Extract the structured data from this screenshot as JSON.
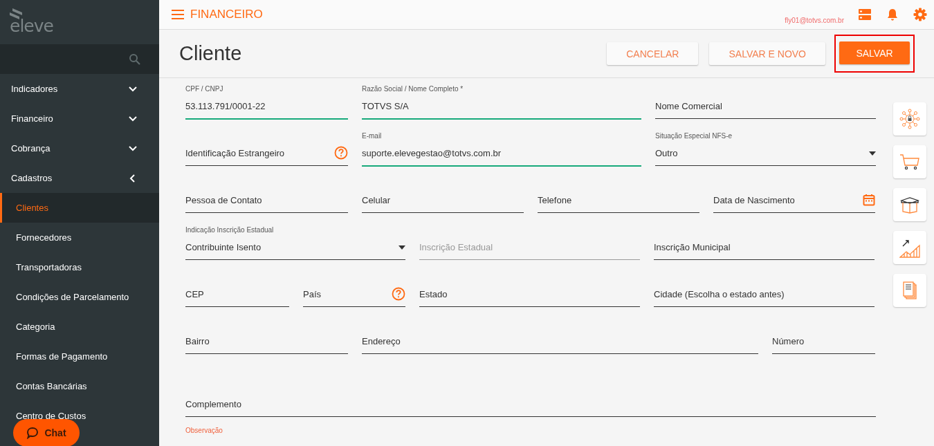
{
  "sidebar": {
    "logo": "eleve",
    "items": [
      {
        "label": "Indicadores",
        "expanded": false
      },
      {
        "label": "Financeiro",
        "expanded": false
      },
      {
        "label": "Cobrança",
        "expanded": false
      },
      {
        "label": "Cadastros",
        "expanded": true,
        "children": [
          {
            "label": "Clientes",
            "selected": true
          },
          {
            "label": "Fornecedores",
            "selected": false
          },
          {
            "label": "Transportadoras",
            "selected": false
          },
          {
            "label": "Condições de Parcelamento",
            "selected": false
          },
          {
            "label": "Categoria",
            "selected": false
          },
          {
            "label": "Formas de Pagamento",
            "selected": false
          },
          {
            "label": "Contas Bancárias",
            "selected": false
          },
          {
            "label": "Centro de Custos",
            "selected": false
          }
        ]
      }
    ]
  },
  "chat": {
    "label": "Chat"
  },
  "topbar": {
    "module": "FINANCEIRO",
    "user": "fly01@totvs.com.br"
  },
  "page": {
    "title": "Cliente",
    "buttons": [
      {
        "label": "CANCELAR",
        "primary": false,
        "highlighted": false
      },
      {
        "label": "SALVAR E NOVO",
        "primary": false,
        "highlighted": false
      },
      {
        "label": "SALVAR",
        "primary": true,
        "highlighted": true
      }
    ]
  },
  "form": {
    "fields": [
      {
        "label": "CPF / CNPJ",
        "value": "53.113.791/0001-22",
        "kind": "text",
        "valid": true,
        "disabled": false
      },
      {
        "label": "Razão Social / Nome Completo *",
        "value": "TOTVS S/A",
        "kind": "text",
        "valid": true,
        "disabled": false
      },
      {
        "label": "Nome Comercial",
        "kind": "text",
        "valid": false,
        "disabled": false
      },
      {
        "label": "Identificação Estrangeiro",
        "kind": "help",
        "valid": false,
        "disabled": false
      },
      {
        "label": "E-mail",
        "value": "suporte.elevegestao@totvs.com.br",
        "kind": "text",
        "valid": true,
        "disabled": false
      },
      {
        "label": "Situação Especial NFS-e",
        "value": "Outro",
        "kind": "select",
        "valid": false,
        "disabled": false
      },
      {
        "label": "Pessoa de Contato",
        "kind": "text",
        "valid": false,
        "disabled": false
      },
      {
        "label": "Celular",
        "kind": "text",
        "valid": false,
        "disabled": false
      },
      {
        "label": "Telefone",
        "kind": "text",
        "valid": false,
        "disabled": false
      },
      {
        "label": "Data de Nascimento",
        "kind": "date",
        "valid": false,
        "disabled": false
      },
      {
        "label": "Indicação Inscrição Estadual",
        "value": "Contribuinte Isento",
        "kind": "select",
        "valid": false,
        "disabled": false
      },
      {
        "label": "Inscrição Estadual",
        "kind": "text",
        "valid": false,
        "disabled": true
      },
      {
        "label": "Inscrição Municipal",
        "kind": "text",
        "valid": false,
        "disabled": false
      },
      {
        "label": "CEP",
        "kind": "text",
        "valid": false,
        "disabled": false
      },
      {
        "label": "País",
        "kind": "help",
        "valid": false,
        "disabled": false
      },
      {
        "label": "Estado",
        "kind": "text",
        "valid": false,
        "disabled": false
      },
      {
        "label": "Cidade (Escolha o estado antes)",
        "kind": "text",
        "valid": false,
        "disabled": false
      },
      {
        "label": "Bairro",
        "kind": "text",
        "valid": false,
        "disabled": false
      },
      {
        "label": "Endereço",
        "kind": "text",
        "valid": false,
        "disabled": false
      },
      {
        "label": "Número",
        "kind": "text",
        "valid": false,
        "disabled": false
      },
      {
        "label": "Complemento",
        "kind": "text",
        "valid": false,
        "disabled": false
      }
    ],
    "observation": {
      "label": "Observação",
      "focused": true
    }
  },
  "side_tools": [
    {
      "kind": "network"
    },
    {
      "kind": "cart"
    },
    {
      "kind": "box"
    },
    {
      "kind": "chart"
    },
    {
      "kind": "documents"
    }
  ]
}
